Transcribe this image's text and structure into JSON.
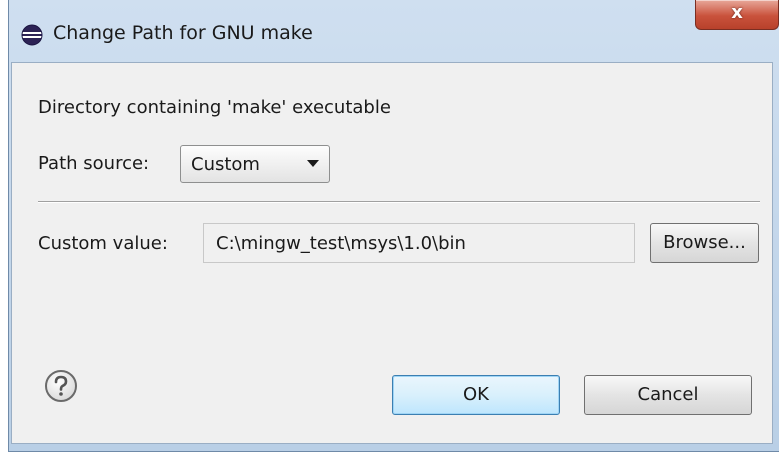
{
  "window": {
    "title": "Change Path for GNU make",
    "close_glyph": "x",
    "app_icon": "eclipse-icon"
  },
  "content": {
    "description": "Directory containing 'make' executable",
    "path_source_label": "Path source:",
    "path_source_value": "Custom",
    "custom_value_label": "Custom value:",
    "custom_value": "C:\\mingw_test\\msys\\1.0\\bin",
    "browse_label": "Browse..."
  },
  "footer": {
    "help_icon": "question-mark-icon",
    "ok_label": "OK",
    "cancel_label": "Cancel"
  }
}
